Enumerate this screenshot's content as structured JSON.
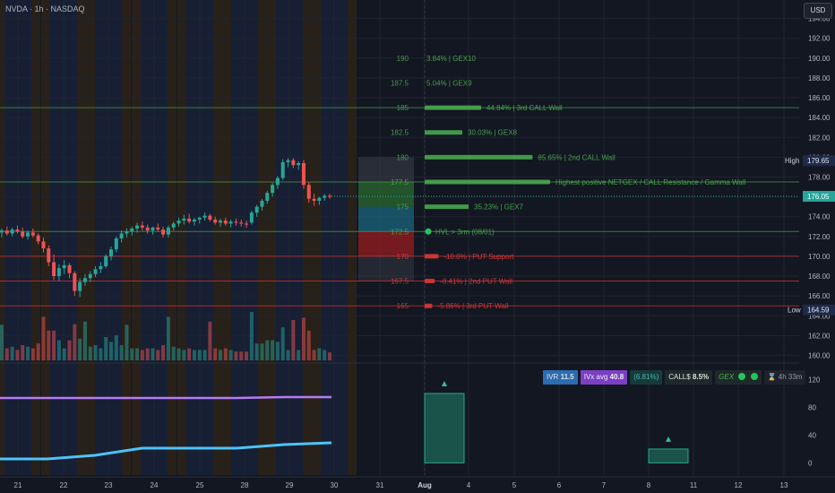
{
  "header": {
    "symbol_line": "NVDA · 1h · NASDAQ",
    "currency_label": "USD"
  },
  "status_bar": {
    "ivr_label": "IVR",
    "ivr_value": "11.5",
    "ivx_label": "IVx avg",
    "ivx_value": "40.8",
    "change_pct": "(6.81%)",
    "calls_label": "CALL$",
    "calls_value": "8.5%",
    "gex_label": "GEX",
    "timer_icon": "hourglass-icon",
    "timer_value": "4h 33m"
  },
  "price_axis": {
    "labels": [
      "194.00",
      "192.00",
      "190.00",
      "188.00",
      "186.00",
      "184.00",
      "182.00",
      "180.00",
      "178.00",
      "176.00",
      "174.00",
      "172.00",
      "170.00",
      "168.00",
      "166.00",
      "164.00",
      "162.00",
      "160.00"
    ],
    "high_label": "High",
    "high_value": "179.65",
    "current_value": "176.05",
    "low_label": "Low",
    "low_value": "164.59"
  },
  "lower_axis": {
    "labels": [
      "120",
      "80",
      "40",
      "0"
    ]
  },
  "time_axis": {
    "labels": [
      "21",
      "22",
      "23",
      "24",
      "25",
      "28",
      "29",
      "30",
      "31",
      "Aug",
      "4",
      "5",
      "6",
      "7",
      "8",
      "11",
      "12",
      "13"
    ]
  },
  "levels": [
    {
      "strike": "190",
      "price": 190,
      "text": "3.84% | GEX10",
      "color": "#4caf50",
      "line": false,
      "bar": 0
    },
    {
      "strike": "187.5",
      "price": 187.5,
      "text": "5.04% | GEX9",
      "color": "#4caf50",
      "line": false,
      "bar": 0
    },
    {
      "strike": "185",
      "price": 185,
      "text": "44.84% | 3rd CALL Wall",
      "color": "#4caf50",
      "line": true,
      "bar": 0.45
    },
    {
      "strike": "182.5",
      "price": 182.5,
      "text": "30.03% | GEX8",
      "color": "#4caf50",
      "line": false,
      "bar": 0.3
    },
    {
      "strike": "180",
      "price": 180,
      "text": "85.65% | 2nd CALL Wall",
      "color": "#4caf50",
      "line": false,
      "bar": 0.86
    },
    {
      "strike": "177.5",
      "price": 177.5,
      "text": "Highest positive NETGEX / CALL Resistance / Gamma Wall",
      "color": "#4caf50",
      "line": true,
      "bar": 1.0
    },
    {
      "strike": "175",
      "price": 175,
      "text": "35.23% | GEX7",
      "color": "#4caf50",
      "line": false,
      "bar": 0.35
    },
    {
      "strike": "172.5",
      "price": 172.5,
      "text": "HVL > 3rm (08/01)",
      "color": "#4caf50",
      "line": true,
      "bar": 0,
      "dot": true
    },
    {
      "strike": "170",
      "price": 170,
      "text": "-10.8% | PUT Support",
      "color": "#e53935",
      "line": true,
      "bar": 0.11
    },
    {
      "strike": "167.5",
      "price": 167.5,
      "text": "-8.41% | 2nd PUT Wall",
      "color": "#e53935",
      "line": true,
      "bar": 0.08
    },
    {
      "strike": "165",
      "price": 165,
      "text": "-5.86% | 3rd PUT Wall",
      "color": "#e53935",
      "line": true,
      "bar": 0.06
    }
  ],
  "chart_data": [
    {
      "type": "candlestick",
      "title": "NVDA · 1h · NASDAQ",
      "y_label": "USD",
      "ylim": [
        159.5,
        195.5
      ],
      "x_categories": [
        "21",
        "22",
        "23",
        "24",
        "25",
        "28",
        "29",
        "30"
      ],
      "ohlc": [
        [
          172.4,
          172.8,
          171.9,
          172.6
        ],
        [
          172.6,
          173.0,
          172.1,
          172.3
        ],
        [
          172.3,
          172.9,
          172.0,
          172.7
        ],
        [
          172.7,
          173.1,
          172.3,
          172.5
        ],
        [
          172.5,
          172.9,
          171.8,
          172.0
        ],
        [
          172.0,
          172.6,
          171.7,
          172.4
        ],
        [
          172.4,
          172.8,
          171.9,
          172.1
        ],
        [
          172.1,
          172.3,
          171.2,
          171.5
        ],
        [
          171.5,
          171.9,
          170.4,
          170.8
        ],
        [
          170.8,
          171.1,
          169.0,
          169.4
        ],
        [
          169.4,
          170.2,
          167.6,
          168.0
        ],
        [
          168.0,
          169.2,
          167.5,
          168.8
        ],
        [
          168.8,
          169.6,
          168.2,
          169.1
        ],
        [
          169.1,
          169.3,
          167.8,
          168.3
        ],
        [
          168.3,
          168.5,
          166.0,
          166.5
        ],
        [
          166.5,
          167.8,
          165.9,
          167.4
        ],
        [
          167.4,
          168.2,
          167.0,
          167.8
        ],
        [
          167.8,
          168.5,
          167.4,
          168.2
        ],
        [
          168.2,
          169.0,
          167.9,
          168.7
        ],
        [
          168.7,
          169.4,
          168.3,
          169.0
        ],
        [
          169.0,
          170.2,
          168.8,
          170.0
        ],
        [
          170.0,
          171.0,
          169.6,
          170.7
        ],
        [
          170.7,
          172.0,
          170.4,
          171.8
        ],
        [
          171.8,
          172.6,
          171.4,
          172.3
        ],
        [
          172.3,
          172.8,
          171.9,
          172.5
        ],
        [
          172.5,
          173.0,
          172.1,
          172.8
        ],
        [
          172.8,
          173.4,
          172.4,
          173.1
        ],
        [
          173.1,
          173.5,
          172.6,
          172.9
        ],
        [
          172.9,
          173.2,
          172.3,
          172.6
        ],
        [
          172.6,
          173.0,
          172.2,
          172.9
        ],
        [
          172.9,
          173.3,
          172.5,
          172.7
        ],
        [
          172.7,
          173.0,
          171.9,
          172.2
        ],
        [
          172.2,
          173.1,
          171.9,
          172.9
        ],
        [
          172.9,
          173.5,
          172.6,
          173.3
        ],
        [
          173.3,
          173.9,
          173.0,
          173.6
        ],
        [
          173.6,
          174.2,
          173.2,
          173.8
        ],
        [
          173.8,
          174.3,
          173.3,
          173.5
        ],
        [
          173.5,
          173.9,
          173.1,
          173.7
        ],
        [
          173.7,
          174.0,
          173.3,
          173.9
        ],
        [
          173.9,
          174.4,
          173.6,
          174.1
        ],
        [
          174.1,
          174.3,
          173.5,
          173.7
        ],
        [
          173.7,
          174.0,
          173.2,
          173.4
        ],
        [
          173.4,
          173.8,
          173.0,
          173.6
        ],
        [
          173.6,
          173.9,
          173.1,
          173.3
        ],
        [
          173.3,
          173.7,
          172.9,
          173.5
        ],
        [
          173.5,
          173.8,
          173.1,
          173.4
        ],
        [
          173.4,
          173.7,
          173.0,
          173.3
        ],
        [
          173.3,
          173.6,
          172.9,
          173.2
        ],
        [
          173.4,
          174.6,
          173.2,
          174.4
        ],
        [
          174.4,
          175.2,
          174.0,
          175.0
        ],
        [
          175.0,
          175.8,
          174.6,
          175.6
        ],
        [
          175.6,
          176.6,
          175.3,
          176.4
        ],
        [
          176.4,
          177.4,
          176.0,
          177.2
        ],
        [
          177.2,
          178.1,
          176.8,
          177.9
        ],
        [
          177.9,
          179.8,
          177.7,
          179.5
        ],
        [
          179.5,
          179.9,
          179.0,
          179.7
        ],
        [
          179.7,
          179.9,
          178.9,
          179.2
        ],
        [
          179.2,
          179.6,
          178.7,
          179.4
        ],
        [
          179.4,
          179.7,
          176.8,
          177.2
        ],
        [
          177.2,
          177.5,
          175.4,
          175.8
        ],
        [
          175.8,
          176.3,
          175.1,
          175.6
        ],
        [
          175.6,
          176.0,
          175.2,
          175.9
        ],
        [
          175.9,
          176.3,
          175.6,
          176.1
        ],
        [
          176.1,
          176.3,
          175.8,
          176.05
        ]
      ]
    },
    {
      "type": "bar",
      "title": "GEX",
      "categories": [
        "Aug",
        "8"
      ],
      "values": [
        100,
        20
      ],
      "ylim": [
        -15,
        140
      ]
    },
    {
      "type": "line",
      "title": "",
      "series": [
        {
          "name": "IVx avg",
          "values": [
            42,
            42,
            42,
            42,
            42,
            42,
            42.5,
            42.5
          ]
        },
        {
          "name": "IVR",
          "values": [
            8,
            8,
            10,
            14,
            14,
            14,
            16,
            17
          ]
        }
      ],
      "ylim": [
        0,
        60
      ]
    }
  ]
}
